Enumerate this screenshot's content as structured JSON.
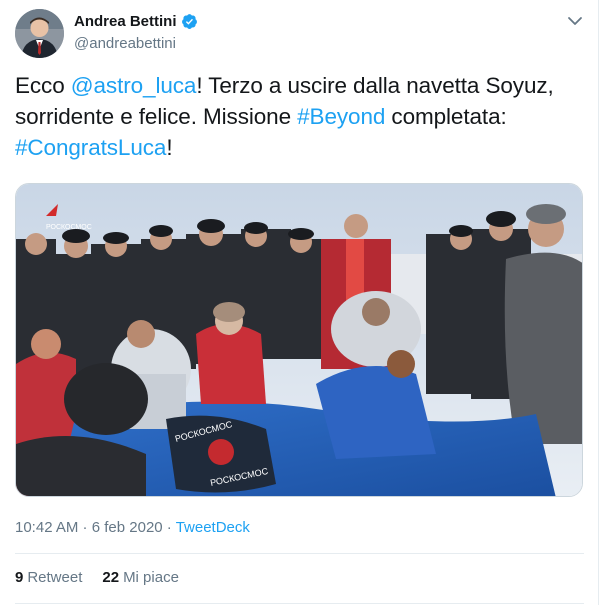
{
  "author": {
    "name": "Andrea Bettini",
    "handle": "@andreabettini"
  },
  "tweet": {
    "t1": "Ecco ",
    "mention": "@astro_luca",
    "t2": "! Terzo a uscire dalla navetta Soyuz, sorridente e felice. Missione ",
    "hashtag1": "#Beyond",
    "t3": " completata: ",
    "hashtag2": "#CongratsLuca",
    "t4": "!"
  },
  "media": {
    "logo_text": "РОСКОСМОС",
    "bag_text_1": "РОСКОСМОС",
    "bag_text_2": "РОСКОСМОС"
  },
  "meta": {
    "time": "10:42 AM",
    "sep": " · ",
    "date": "6 feb 2020",
    "source": "TweetDeck"
  },
  "stats": {
    "retweets_count": "9",
    "retweets_label": "Retweet",
    "likes_count": "22",
    "likes_label": "Mi piace"
  },
  "colors": {
    "link": "#1da1f2",
    "secondary_text": "#657786",
    "verified_badge": "#1da1f2"
  },
  "icons": [
    "verified-badge-icon",
    "chevron-down-icon"
  ]
}
